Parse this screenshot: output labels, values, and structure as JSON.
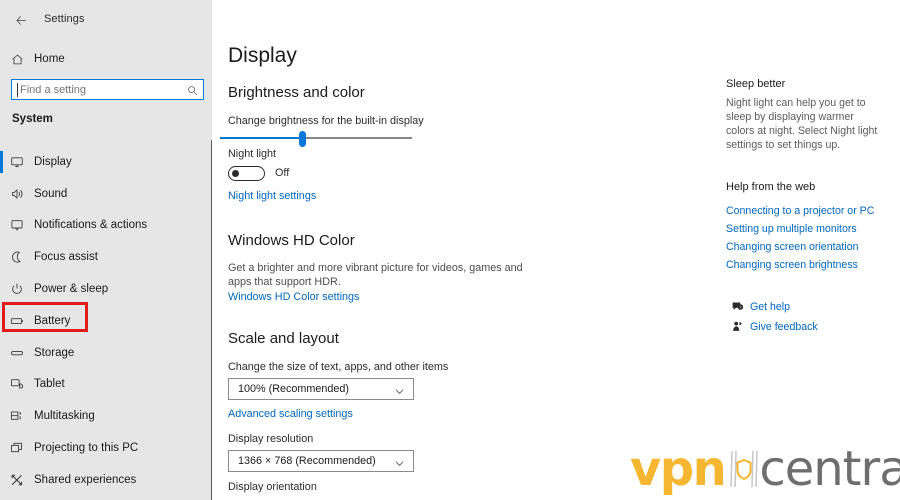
{
  "window": {
    "title": "Settings",
    "back_icon": "back-arrow-icon",
    "controls": {
      "minimize": "minimize-icon",
      "restore": "restore-icon",
      "close": "close-icon"
    }
  },
  "sidebar": {
    "home_label": "Home",
    "home_icon": "home-icon",
    "search": {
      "placeholder": "Find a setting",
      "value": "",
      "icon": "search-icon"
    },
    "group_label": "System",
    "items": [
      {
        "label": "Display",
        "icon": "display-monitor-icon",
        "selected": true
      },
      {
        "label": "Sound",
        "icon": "speaker-sound-icon",
        "selected": false
      },
      {
        "label": "Notifications & actions",
        "icon": "notification-icon",
        "selected": false
      },
      {
        "label": "Focus assist",
        "icon": "moon-icon",
        "selected": false
      },
      {
        "label": "Power & sleep",
        "icon": "power-icon",
        "selected": false
      },
      {
        "label": "Battery",
        "icon": "battery-icon",
        "selected": false,
        "highlighted": true
      },
      {
        "label": "Storage",
        "icon": "storage-icon",
        "selected": false
      },
      {
        "label": "Tablet",
        "icon": "tablet-icon",
        "selected": false
      },
      {
        "label": "Multitasking",
        "icon": "multitasking-icon",
        "selected": false
      },
      {
        "label": "Projecting to this PC",
        "icon": "projecting-icon",
        "selected": false
      },
      {
        "label": "Shared experiences",
        "icon": "shared-experiences-icon",
        "selected": false
      }
    ],
    "highlight_color": "#e01b1b",
    "accent_color": "#0078d7"
  },
  "main": {
    "page_title": "Display",
    "brightness_section": {
      "heading": "Brightness and color",
      "slider_label": "Change brightness for the built-in display",
      "slider_value_percent": 43,
      "night_light_label": "Night light",
      "night_light_state": "Off",
      "night_light_link": "Night light settings"
    },
    "hdr_section": {
      "heading": "Windows HD Color",
      "description": "Get a brighter and more vibrant picture for videos, games and apps that support HDR.",
      "link": "Windows HD Color settings"
    },
    "scale_section": {
      "heading": "Scale and layout",
      "scale_label": "Change the size of text, apps, and other items",
      "scale_value": "100% (Recommended)",
      "advanced_link": "Advanced scaling settings",
      "resolution_label": "Display resolution",
      "resolution_value": "1366 × 768 (Recommended)",
      "orientation_label": "Display orientation"
    }
  },
  "right_panel": {
    "tip_heading": "Sleep better",
    "tip_body": "Night light can help you get to sleep by displaying warmer colors at night. Select Night light settings to set things up.",
    "help_heading": "Help from the web",
    "help_links": [
      "Connecting to a projector or PC",
      "Setting up multiple monitors",
      "Changing screen orientation",
      "Changing screen brightness"
    ],
    "footer": [
      {
        "label": "Get help",
        "icon": "get-help-icon"
      },
      {
        "label": "Give feedback",
        "icon": "give-feedback-icon"
      }
    ]
  },
  "watermark": {
    "text_primary": "vpn",
    "text_secondary": "central",
    "mark_icon": "shield-logo-icon",
    "color_primary": "#f5b731",
    "color_secondary": "#6e6e6e"
  }
}
